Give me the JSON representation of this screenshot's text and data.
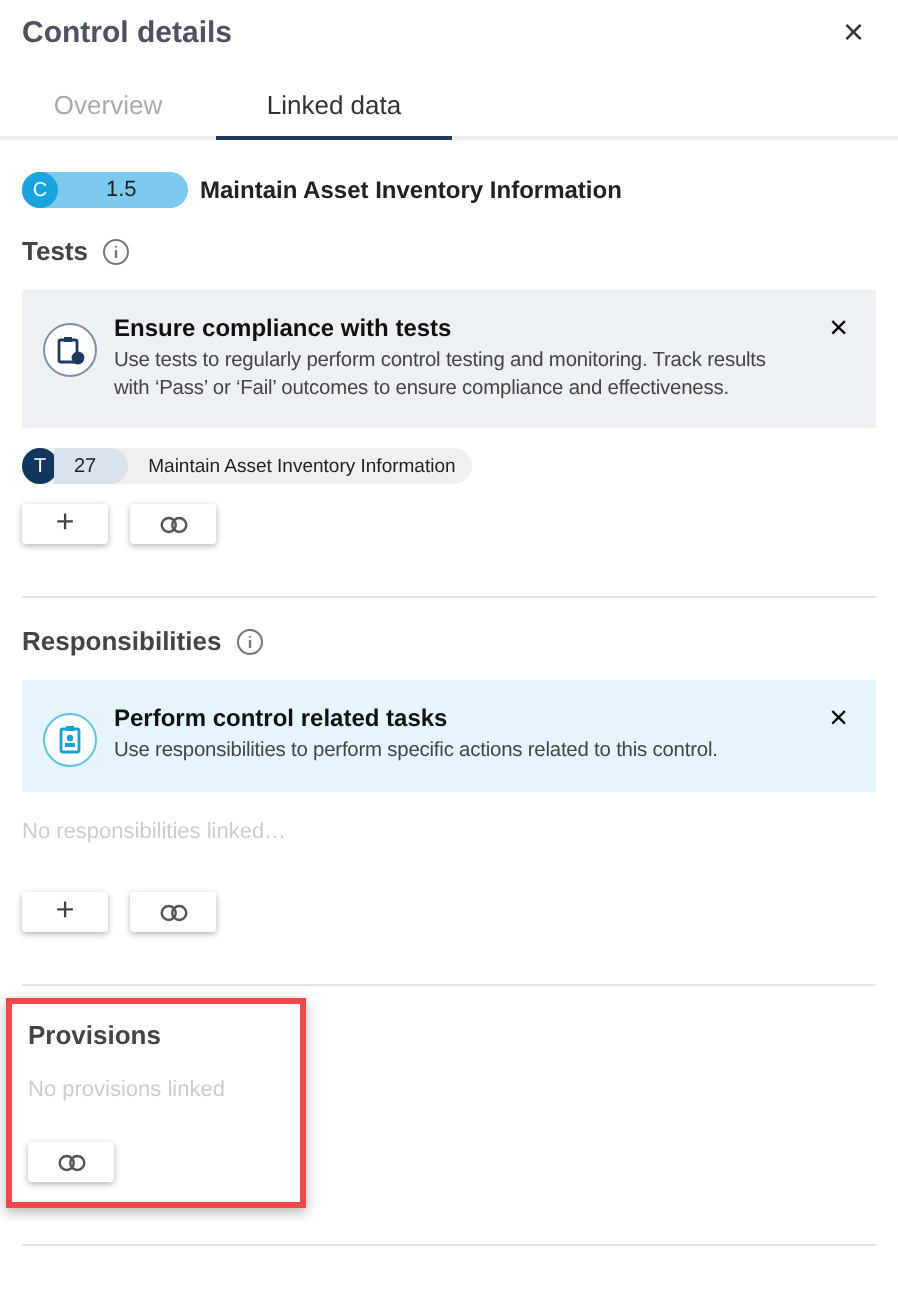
{
  "panel": {
    "title": "Control details",
    "close": "×"
  },
  "tabs": [
    {
      "label": "Overview",
      "selected": false
    },
    {
      "label": "Linked data",
      "selected": true
    }
  ],
  "control_chip": {
    "kind": "control",
    "letter": "C",
    "number": "1.5",
    "title": "Maintain Asset Inventory Information"
  },
  "sections": [
    {
      "title": "Tests",
      "info": true,
      "highlighted": false,
      "banner": {
        "kind": "test",
        "title": "Ensure compliance with tests",
        "text": "Use tests to regularly perform control testing and monitoring. Track results with ‘Pass’ or ‘Fail’ outcomes to ensure compliance and effectiveness.",
        "close": "×"
      },
      "items": [
        {
          "kind": "test",
          "letter": "T",
          "number": "27",
          "title": "Maintain Asset Inventory Information"
        }
      ],
      "buttons": [
        {
          "kind": "add",
          "label": "+"
        },
        {
          "kind": "link"
        }
      ]
    },
    {
      "title": "Responsibilities",
      "info": true,
      "highlighted": false,
      "banner": {
        "kind": "task",
        "title": "Perform control related tasks",
        "text": "Use responsibilities to perform specific actions related to this control.",
        "close": "×"
      },
      "empty_text": "No responsibilities linked…",
      "buttons": [
        {
          "kind": "add",
          "label": "+"
        },
        {
          "kind": "link"
        }
      ]
    },
    {
      "title": "Provisions",
      "info": false,
      "highlighted": true,
      "empty_text": "No provisions linked",
      "buttons": [
        {
          "kind": "link"
        }
      ]
    }
  ]
}
